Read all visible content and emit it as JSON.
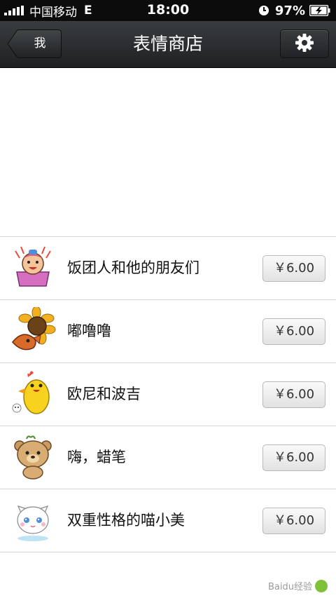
{
  "status_bar": {
    "carrier": "中国移动",
    "network": "E",
    "time": "18:00",
    "battery": "97%"
  },
  "nav": {
    "back_label": "我",
    "title": "表情商店",
    "settings_icon": "gear-icon"
  },
  "stickers": [
    {
      "name": "饭团人和他的朋友们",
      "price": "￥6.00",
      "icon": "rice-ball-girl"
    },
    {
      "name": "嘟噜噜",
      "price": "￥6.00",
      "icon": "sunflower-fish"
    },
    {
      "name": "欧尼和波吉",
      "price": "￥6.00",
      "icon": "yellow-chick"
    },
    {
      "name": "嗨，蜡笔",
      "price": "￥6.00",
      "icon": "brown-bear"
    },
    {
      "name": "双重性格的喵小美",
      "price": "￥6.00",
      "icon": "white-cat"
    }
  ],
  "watermark": "Baidu经验",
  "colors": {
    "nav_bg": "#2b2d30",
    "status_bg": "#0c0c0c",
    "divider": "#d6d6d6"
  }
}
